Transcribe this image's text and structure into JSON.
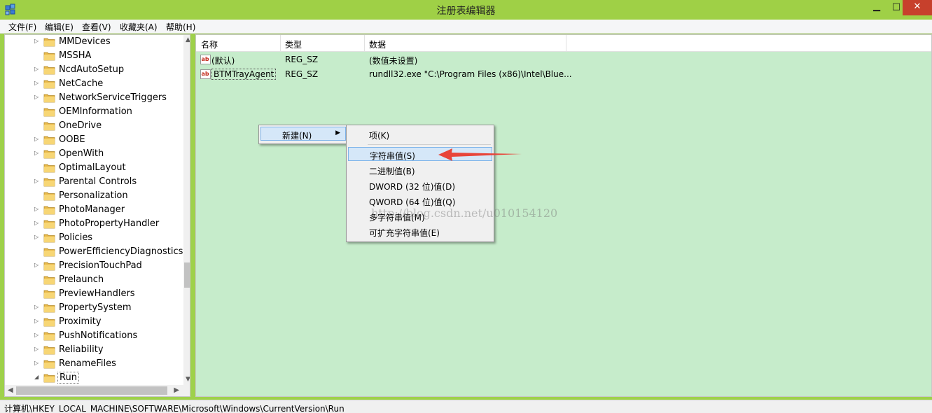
{
  "window": {
    "title": "注册表编辑器",
    "icon": "registry-editor-icon",
    "controls": {
      "minimize": "▁",
      "maximize": "□",
      "close": "✕"
    }
  },
  "menubar": {
    "items": [
      "文件(F)",
      "编辑(E)",
      "查看(V)",
      "收藏夹(A)",
      "帮助(H)"
    ]
  },
  "tree": {
    "items": [
      {
        "label": "MMDevices",
        "expandable": true
      },
      {
        "label": "MSSHA",
        "expandable": false
      },
      {
        "label": "NcdAutoSetup",
        "expandable": true
      },
      {
        "label": "NetCache",
        "expandable": true
      },
      {
        "label": "NetworkServiceTriggers",
        "expandable": true
      },
      {
        "label": "OEMInformation",
        "expandable": false
      },
      {
        "label": "OneDrive",
        "expandable": false
      },
      {
        "label": "OOBE",
        "expandable": true
      },
      {
        "label": "OpenWith",
        "expandable": true
      },
      {
        "label": "OptimalLayout",
        "expandable": false
      },
      {
        "label": "Parental Controls",
        "expandable": true
      },
      {
        "label": "Personalization",
        "expandable": false
      },
      {
        "label": "PhotoManager",
        "expandable": true
      },
      {
        "label": "PhotoPropertyHandler",
        "expandable": true
      },
      {
        "label": "Policies",
        "expandable": true
      },
      {
        "label": "PowerEfficiencyDiagnostics",
        "expandable": false
      },
      {
        "label": "PrecisionTouchPad",
        "expandable": true
      },
      {
        "label": "Prelaunch",
        "expandable": false
      },
      {
        "label": "PreviewHandlers",
        "expandable": false
      },
      {
        "label": "PropertySystem",
        "expandable": true
      },
      {
        "label": "Proximity",
        "expandable": true
      },
      {
        "label": "PushNotifications",
        "expandable": true
      },
      {
        "label": "Reliability",
        "expandable": true
      },
      {
        "label": "RenameFiles",
        "expandable": true
      },
      {
        "label": "Run",
        "expandable": true,
        "expanded": true,
        "selected": true
      }
    ]
  },
  "list": {
    "columns": [
      "名称",
      "类型",
      "数据"
    ],
    "rows": [
      {
        "name": "(默认)",
        "type": "REG_SZ",
        "data": "(数值未设置)"
      },
      {
        "name": "BTMTrayAgent",
        "type": "REG_SZ",
        "data": "rundll32.exe \"C:\\Program Files (x86)\\Intel\\Blue..."
      }
    ]
  },
  "context_menu": {
    "parent_item": "新建(N)",
    "submenu": [
      "项(K)",
      "字符串值(S)",
      "二进制值(B)",
      "DWORD (32 位)值(D)",
      "QWORD (64 位)值(Q)",
      "多字符串值(M)",
      "可扩充字符串值(E)"
    ],
    "highlighted": "字符串值(S)"
  },
  "watermark": "http://blog.csdn.net/u010154120",
  "statusbar": {
    "path": "计算机\\HKEY_LOCAL_MACHINE\\SOFTWARE\\Microsoft\\Windows\\CurrentVersion\\Run"
  },
  "colors": {
    "titlebar": "#9fd046",
    "list_background": "#c6eccb",
    "close_button": "#c7402c",
    "menu_highlight": "#d5e7f8",
    "annotation_arrow": "#e8443a"
  }
}
